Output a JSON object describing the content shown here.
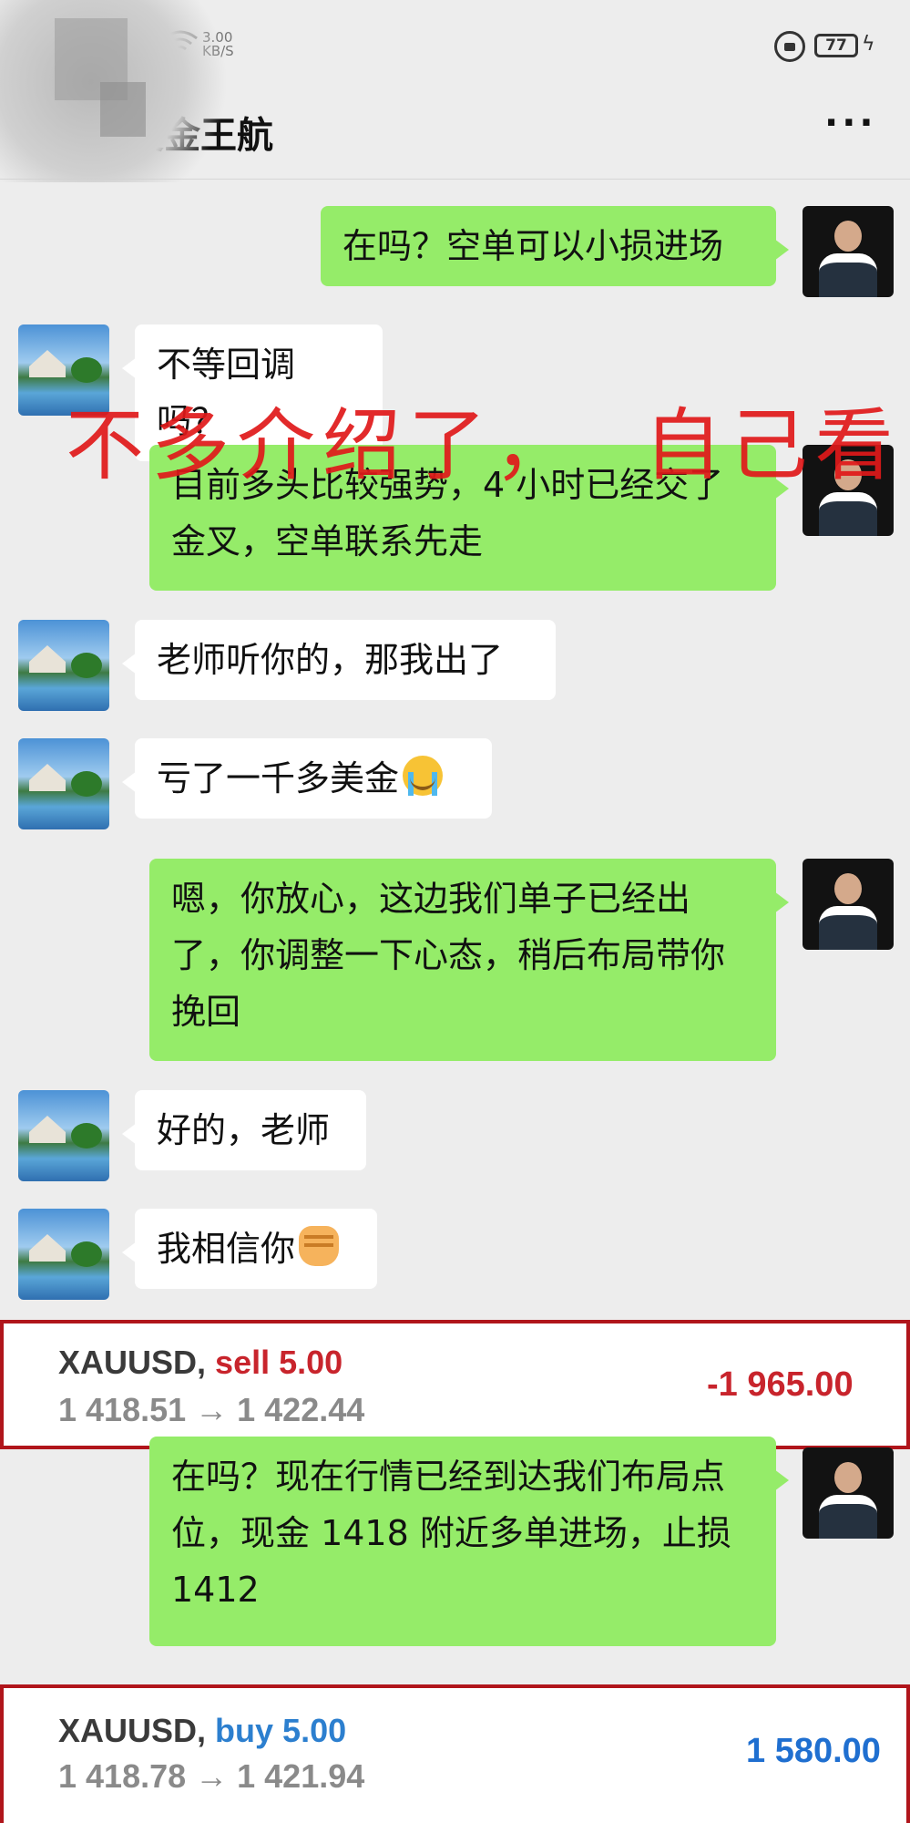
{
  "status_bar": {
    "net_speed_value": "3.00",
    "net_speed_unit": "KB/S",
    "battery_level": "77"
  },
  "header": {
    "title": "美金王航",
    "back_icon": "chevron-left-icon",
    "more_label": "···"
  },
  "watermark": "不多介绍了，  自己看",
  "messages": [
    {
      "side": "right",
      "text": "在吗？空单可以小损进场"
    },
    {
      "side": "left",
      "text": "不等回调吗？"
    },
    {
      "side": "right",
      "text": "目前多头比较强势，4 小时已经交了金叉，空单联系先走"
    },
    {
      "side": "left",
      "text": "老师听你的，那我出了"
    },
    {
      "side": "left",
      "text": "亏了一千多美金",
      "emoji": "crying-face-emoji"
    },
    {
      "side": "right",
      "text": "嗯，你放心，这边我们单子已经出了，你调整一下心态，稍后布局带你挽回"
    },
    {
      "side": "left",
      "text": "好的，老师"
    },
    {
      "side": "left",
      "text": "我相信你",
      "emoji": "fist-emoji"
    },
    {
      "side": "right",
      "text": "在吗？现在行情已经到达我们布局点位，现金 1418 附近多单进场，止损 1412"
    }
  ],
  "trades": [
    {
      "symbol": "XAUUSD,",
      "action": "sell 5.00",
      "action_color": "#c8242c",
      "prices": "1 418.51 → 1 422.44",
      "pnl": "-1 965.00",
      "pnl_color": "#c8242c"
    },
    {
      "symbol": "XAUUSD,",
      "action": "buy 5.00",
      "action_color": "#2c7fcf",
      "prices": "1 418.78 → 1 421.94",
      "pnl": "1 580.00",
      "pnl_color": "#1f6fd0"
    }
  ],
  "colors": {
    "bubble_out": "#95ec69",
    "bubble_in": "#ffffff",
    "background": "#ededed",
    "trade_border": "#b0151b"
  }
}
